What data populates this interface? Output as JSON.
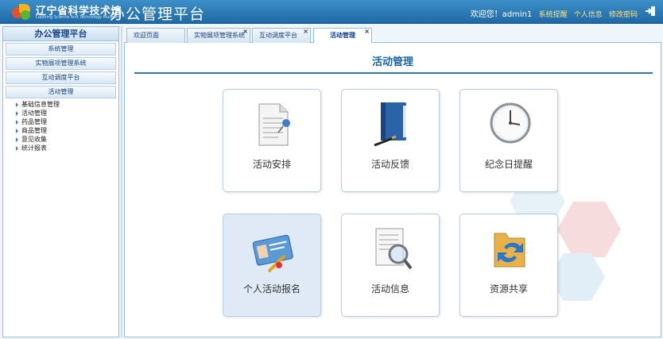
{
  "header": {
    "org_name": "辽宁省科学技术馆",
    "org_name_en": "Liaoning Science And Technology Museum",
    "app_title": "办公管理平台",
    "welcome": "欢迎您！admin1",
    "links": [
      "系统提醒",
      "个人信息",
      "修改密码"
    ]
  },
  "sidebar": {
    "title": "办公管理平台",
    "sections": [
      "系统管理",
      "实物展项管理系统",
      "互动调度平台",
      "活动管理"
    ],
    "tree": [
      "基础信息管理",
      "活动管理",
      "药品管理",
      "商品管理",
      "意见收集",
      "统计报表"
    ]
  },
  "tabs": [
    {
      "label": "欢迎页面",
      "closable": false
    },
    {
      "label": "实物展项管理系统",
      "closable": true
    },
    {
      "label": "互动调度平台",
      "closable": true
    },
    {
      "label": "活动管理",
      "closable": true,
      "active": true
    }
  ],
  "main": {
    "title": "活动管理",
    "cards": [
      {
        "label": "活动安排",
        "icon": "document-pin-icon"
      },
      {
        "label": "活动反馈",
        "icon": "notebook-pen-icon"
      },
      {
        "label": "纪念日提醒",
        "icon": "clock-icon"
      },
      {
        "label": "个人活动报名",
        "icon": "id-card-icon",
        "highlighted": true
      },
      {
        "label": "活动信息",
        "icon": "magnifier-document-icon"
      },
      {
        "label": "资源共享",
        "icon": "folder-share-icon"
      }
    ]
  },
  "colors": {
    "header": "#2b7cbf",
    "accent": "#1b64a8",
    "link": "#ffe27a"
  }
}
